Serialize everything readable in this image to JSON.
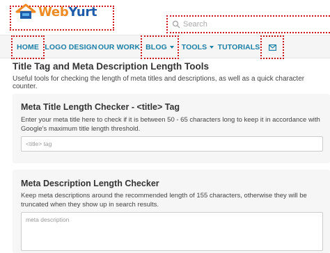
{
  "logo": {
    "part1": "Web",
    "part2": "Yurt"
  },
  "search": {
    "placeholder": "Search",
    "icon": "search-icon"
  },
  "nav": [
    {
      "label": "HOME"
    },
    {
      "label": "LOGO DESIGN"
    },
    {
      "label": "OUR WORK"
    },
    {
      "label": "BLOG"
    },
    {
      "label": "TOOLS"
    },
    {
      "label": "TUTORIALS"
    }
  ],
  "nav_mail_icon": "envelope-icon",
  "page": {
    "title": "Title Tag and Meta Description Length Tools",
    "description": "Useful tools for checking the length of meta titles and descriptions, as well as a quick character counter."
  },
  "title_checker": {
    "heading": "Meta Title Length Checker - <title> Tag",
    "description": "Enter your meta title here to check if it is between 50 - 65 characters long to keep it in accordance with Google's maximum title length threshold.",
    "placeholder": "<title> tag"
  },
  "desc_checker": {
    "heading": "Meta Description Length Checker",
    "description": "Keep meta descriptions around the recommended length of 155 characters, otherwise they will be truncated when they show up in search results.",
    "placeholder": "meta description"
  },
  "colors": {
    "accent": "#1a7fa6",
    "logo_orange": "#f08a24",
    "logo_blue": "#1e5ba8",
    "highlight": "#d0141c"
  }
}
